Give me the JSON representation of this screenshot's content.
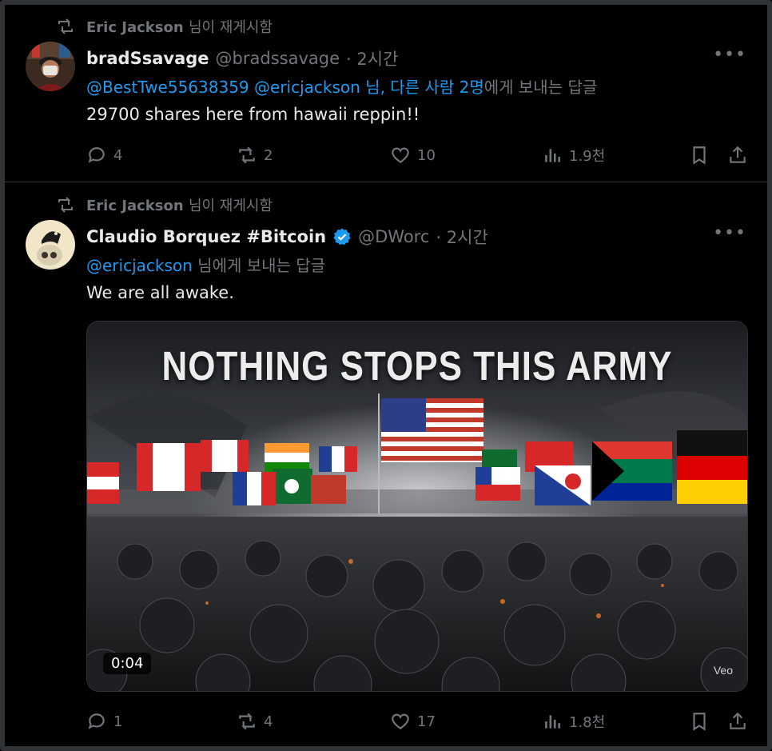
{
  "tweets": [
    {
      "reposted_by": "Eric Jackson",
      "reposted_suffix": "님이 재게시함",
      "name": "bradSsavage",
      "handle": "@bradssavage",
      "time": "· 2시간",
      "reply_mentions": "@BestTwe55638359 @ericjackson",
      "reply_others": "님, 다른 사람 2명",
      "reply_suffix": "에게 보내는 답글",
      "text": "29700 shares here from hawaii reppin!!",
      "replies": "4",
      "reposts": "2",
      "likes": "10",
      "views": "1.9천"
    },
    {
      "reposted_by": "Eric Jackson",
      "reposted_suffix": "님이 재게시함",
      "name": "Claudio Borquez #Bitcoin",
      "handle": "@DWorc",
      "time": "· 2시간",
      "reply_mentions": "@ericjackson",
      "reply_suffix": "님에게 보내는 답글",
      "text": "We are all awake.",
      "video_title": "NOTHING STOPS THIS ARMY",
      "video_duration": "0:04",
      "video_watermark": "Veo",
      "replies": "1",
      "reposts": "4",
      "likes": "17",
      "views": "1.8천"
    }
  ],
  "colors": {
    "background": "#000000",
    "text": "#e7e9ea",
    "muted": "#71767b",
    "link": "#1d9bf0",
    "border": "#2f3336"
  },
  "icons": [
    "repost-icon",
    "more-icon",
    "reply-icon",
    "like-icon",
    "views-icon",
    "bookmark-icon",
    "share-icon",
    "verified-badge-icon"
  ]
}
